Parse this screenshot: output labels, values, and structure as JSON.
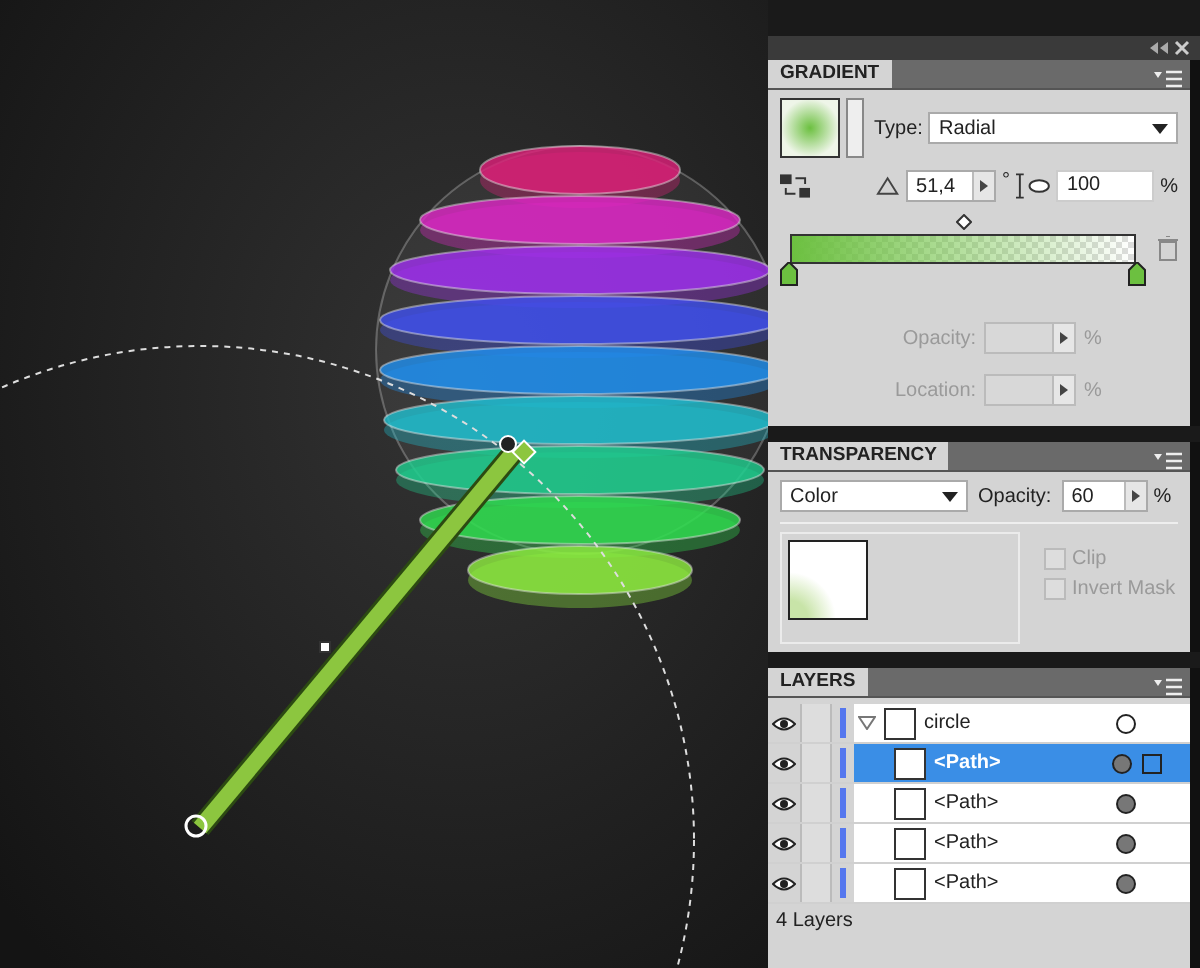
{
  "gradient": {
    "title": "GRADIENT",
    "type_label": "Type:",
    "type": "Radial",
    "angle": "51,4",
    "angle_unit": "°",
    "aspect": "100",
    "aspect_unit": "%",
    "midpoint": {
      "level": 0.5
    },
    "opacity": {
      "label": "Opacity:",
      "unit": "%",
      "disabled": true
    },
    "location": {
      "label": "Location:",
      "unit": "%",
      "disabled": true
    }
  },
  "transparency": {
    "title": "TRANSPARENCY",
    "blend_mode": "Color",
    "opacity_label": "Opacity:",
    "opacity": "60",
    "opacity_unit": "%",
    "options": [
      {
        "label": "Clip",
        "checked": false
      },
      {
        "label": "Invert Mask",
        "checked": false
      }
    ]
  },
  "layers": {
    "title": "LAYERS",
    "rows": [
      {
        "name": "circle",
        "visible": true,
        "expanded": true,
        "selected": false,
        "children": [
          {
            "name": "<Path>",
            "visible": true,
            "selected": true
          },
          {
            "name": "<Path>",
            "visible": true,
            "selected": false
          },
          {
            "name": "<Path>",
            "visible": true,
            "selected": false
          },
          {
            "name": "<Path>",
            "visible": true,
            "selected": false
          }
        ]
      }
    ],
    "status": "4 Layers"
  }
}
